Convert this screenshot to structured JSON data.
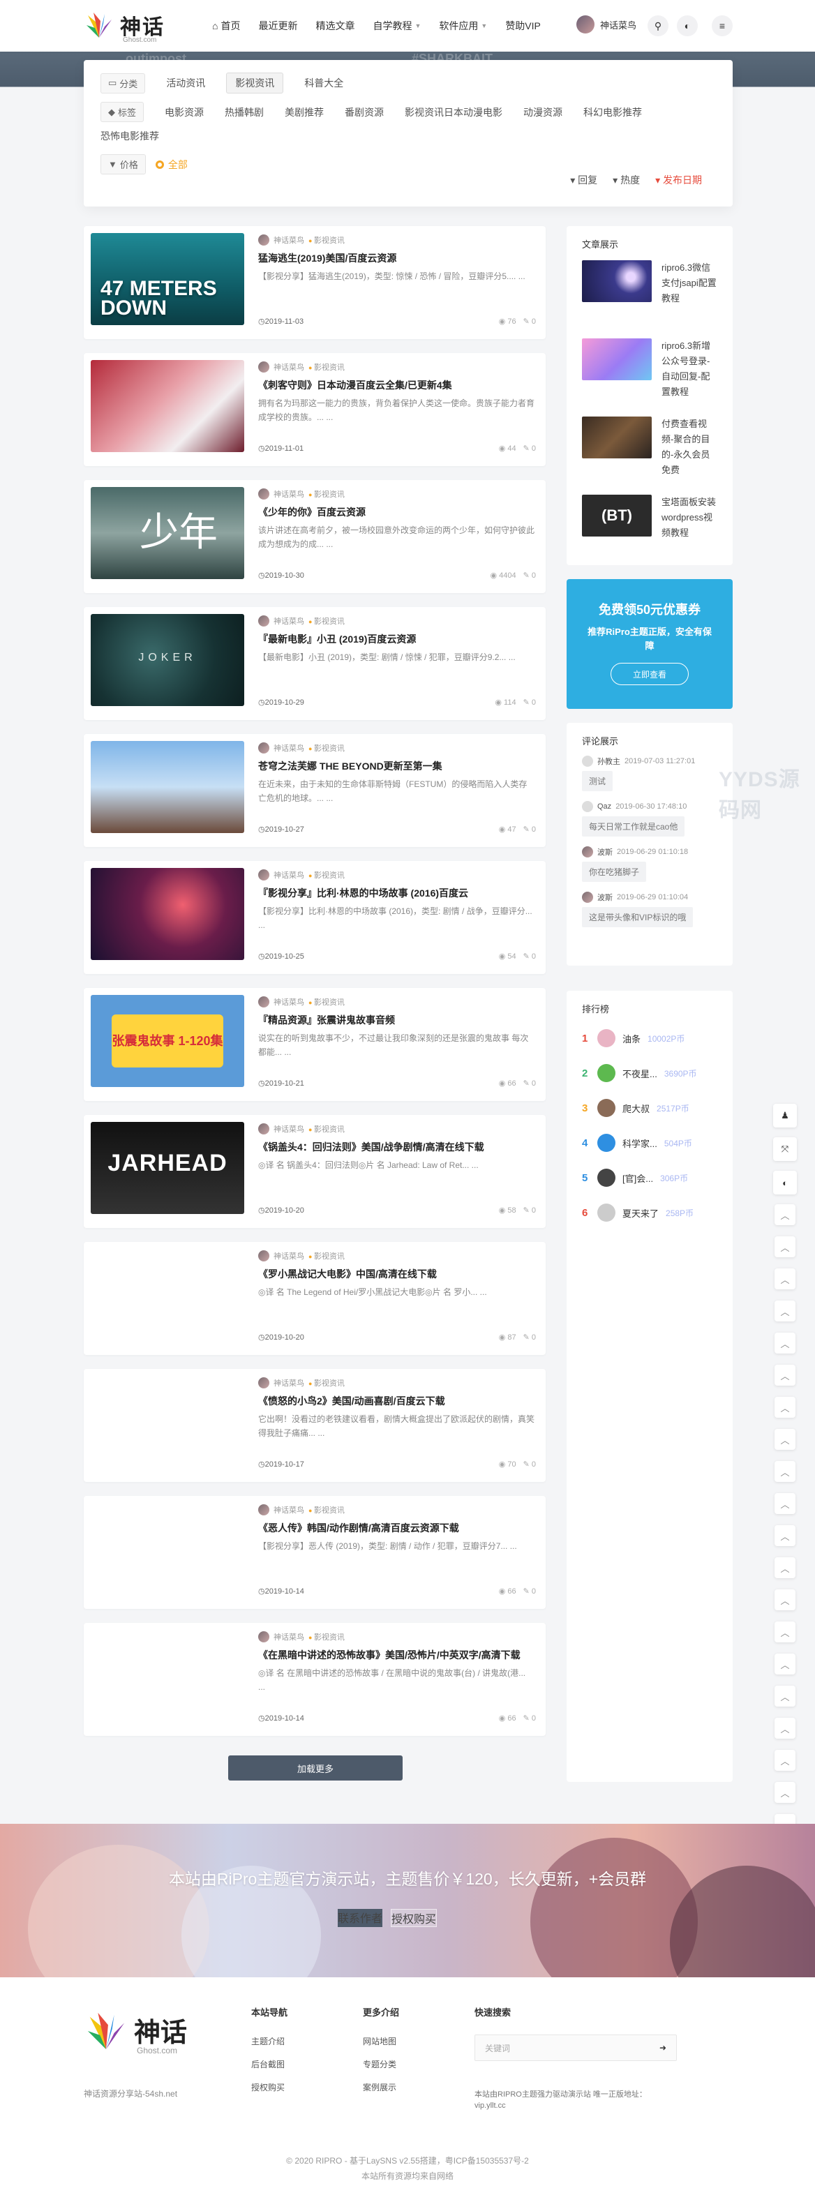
{
  "header": {
    "brand": "神话",
    "brand_sub": "Ghost.com",
    "nav": [
      {
        "label": "首页",
        "icon": "home-icon",
        "caret": false
      },
      {
        "label": "最近更新",
        "caret": false
      },
      {
        "label": "精选文章",
        "caret": false
      },
      {
        "label": "自学教程",
        "caret": true
      },
      {
        "label": "软件应用",
        "caret": true
      },
      {
        "label": "赞助VIP",
        "caret": false
      }
    ],
    "user_name": "神话菜鸟"
  },
  "hero_ghost": [
    "outimpost",
    "#SHARKBAIT"
  ],
  "filters": {
    "category_label": "分类",
    "categories": [
      "活动资讯",
      "影视资讯",
      "科普大全"
    ],
    "active_category": "影视资讯",
    "tag_label": "标签",
    "tags": [
      "电影资源",
      "热播韩剧",
      "美剧推荐",
      "番剧资源",
      "影视资讯日本动漫电影",
      "动漫资源",
      "科幻电影推荐",
      "恐怖电影推荐"
    ],
    "price_label": "价格",
    "price_all": "全部",
    "sort": [
      "回复",
      "热度",
      "发布日期"
    ]
  },
  "posts": [
    {
      "author": "神话菜鸟",
      "cat": "影视资讯",
      "title": "猛海逃生(2019)美国/百度云资源",
      "excerpt": "【影视分享】猛海逃生(2019)，类型: 惊悚 / 恐怖 / 冒险，豆瓣评分5.... ...",
      "date": "2019-11-03",
      "views": "76",
      "comments": "0",
      "thumb_text": "47 METERS DOWN"
    },
    {
      "author": "神话菜鸟",
      "cat": "影视资讯",
      "title": "《刺客守则》日本动漫百度云全集/已更新4集",
      "excerpt": "拥有名为玛那这一能力的贵族，背负着保护人类这一使命。贵族子能力者育成学校的贵族。... ...",
      "date": "2019-11-01",
      "views": "44",
      "comments": "0",
      "thumb_text": ""
    },
    {
      "author": "神话菜鸟",
      "cat": "影视资讯",
      "title": "《少年的你》百度云资源",
      "excerpt": "该片讲述在高考前夕，被一场校园意外改变命运的两个少年，如何守护彼此成为想成为的成... ...",
      "date": "2019-10-30",
      "views": "4404",
      "comments": "0",
      "thumb_text": "少年"
    },
    {
      "author": "神话菜鸟",
      "cat": "影视资讯",
      "title": "『最新电影』小丑 (2019)百度云资源",
      "excerpt": "【最新电影】小丑 (2019)，类型: 剧情 / 惊悚 / 犯罪，豆瓣评分9.2... ...",
      "date": "2019-10-29",
      "views": "114",
      "comments": "0",
      "thumb_text": "JOKER"
    },
    {
      "author": "神话菜鸟",
      "cat": "影视资讯",
      "title": "苍穹之法芙娜 THE BEYOND更新至第一集",
      "excerpt": "在近未来，由于未知的生命体菲斯特姆（FESTUM）的侵略而陷入人类存亡危机的地球。... ...",
      "date": "2019-10-27",
      "views": "47",
      "comments": "0",
      "thumb_text": ""
    },
    {
      "author": "神话菜鸟",
      "cat": "影视资讯",
      "title": "『影视分享』比利·林恩的中场故事 (2016)百度云",
      "excerpt": "【影视分享】比利·林恩的中场故事 (2016)，类型: 剧情 / 战争，豆瓣评分... ...",
      "date": "2019-10-25",
      "views": "54",
      "comments": "0",
      "thumb_text": ""
    },
    {
      "author": "神话菜鸟",
      "cat": "影视资讯",
      "title": "『精品资源』张震讲鬼故事音频",
      "excerpt": "说实在的听到鬼故事不少，不过最让我印象深刻的还是张震的鬼故事 每次都能... ...",
      "date": "2019-10-21",
      "views": "66",
      "comments": "0",
      "thumb_text": "张震鬼故事 1-120集"
    },
    {
      "author": "神话菜鸟",
      "cat": "影视资讯",
      "title": "《锅盖头4：回归法则》美国/战争剧情/高清在线下载",
      "excerpt": "◎译 名 锅盖头4：回归法则◎片 名 Jarhead: Law of Ret... ...",
      "date": "2019-10-20",
      "views": "58",
      "comments": "0",
      "thumb_text": "JARHEAD"
    },
    {
      "author": "神话菜鸟",
      "cat": "影视资讯",
      "title": "《罗小黑战记大电影》中国/高清在线下载",
      "excerpt": "◎译 名 The Legend of Hei/罗小黑战记大电影◎片 名 罗小... ...",
      "date": "2019-10-20",
      "views": "87",
      "comments": "0",
      "thumb_text": ""
    },
    {
      "author": "神话菜鸟",
      "cat": "影视资讯",
      "title": "《愤怒的小鸟2》美国/动画喜剧/百度云下载",
      "excerpt": "它出啊！没看过的老铁建议看看，剧情大概盒提出了欧派起伏的剧情，真笑得我肚子痛痛... ...",
      "date": "2019-10-17",
      "views": "70",
      "comments": "0",
      "thumb_text": ""
    },
    {
      "author": "神话菜鸟",
      "cat": "影视资讯",
      "title": "《恶人传》韩国/动作剧情/高清百度云资源下载",
      "excerpt": "【影视分享】恶人传 (2019)，类型: 剧情 / 动作 / 犯罪，豆瓣评分7... ...",
      "date": "2019-10-14",
      "views": "66",
      "comments": "0",
      "thumb_text": ""
    },
    {
      "author": "神话菜鸟",
      "cat": "影视资讯",
      "title": "《在黑暗中讲述的恐怖故事》美国/恐怖片/中英双字/高清下载",
      "excerpt": "◎译 名 在黑暗中讲述的恐怖故事 / 在黑暗中说的鬼故事(台) / 讲鬼故(港... ...",
      "date": "2019-10-14",
      "views": "66",
      "comments": "0",
      "thumb_text": ""
    }
  ],
  "load_more": "加载更多",
  "sidebar": {
    "articles_title": "文章展示",
    "articles": [
      {
        "title": "ripro6.3微信支付jsapi配置教程"
      },
      {
        "title": "ripro6.3新增公众号登录-自动回复-配置教程"
      },
      {
        "title": "付费查看视频-聚合的目的-永久会员免费"
      },
      {
        "title": "宝塔面板安装wordpress视频教程"
      }
    ],
    "promo": {
      "title": "免费领50元优惠券",
      "text": "推荐RiPro主题正版，安全有保障",
      "button": "立即查看"
    },
    "comments_title": "评论展示",
    "comments": [
      {
        "user": "孙教主",
        "time": "2019-07-03 11:27:01",
        "text": "测试"
      },
      {
        "user": "Qaz",
        "time": "2019-06-30 17:48:10",
        "text": "每天日常工作就是cao他"
      },
      {
        "user": "波斯",
        "time": "2019-06-29 01:10:18",
        "text": "你在吃猪脚子"
      },
      {
        "user": "波斯",
        "time": "2019-06-29 01:10:04",
        "text": "这是带头像和VIP标识的哦"
      }
    ],
    "rank_title": "排行榜",
    "ranks": [
      {
        "n": "1",
        "name": "油条",
        "pts": "10002P币",
        "color": "#e64b3c"
      },
      {
        "n": "2",
        "name": "不夜星...",
        "pts": "3690P币",
        "color": "#3cb371"
      },
      {
        "n": "3",
        "name": "爬大叔",
        "pts": "2517P币",
        "color": "#f5a623"
      },
      {
        "n": "4",
        "name": "科学家...",
        "pts": "504P币",
        "color": "#2e8fe1"
      },
      {
        "n": "5",
        "name": "[官]会...",
        "pts": "306P币",
        "color": "#2e8fe1"
      },
      {
        "n": "6",
        "name": "夏天来了",
        "pts": "258P币",
        "color": "#e64b3c"
      }
    ]
  },
  "watermark": "YYDS源码网",
  "banner": {
    "text": "本站由RiPro主题官方演示站，主题售价￥120，长久更新，+会员群",
    "btn1": "联系作者",
    "btn2": "授权购买"
  },
  "footer": {
    "desc": "神话资源分享站-54sh.net",
    "cols": [
      {
        "title": "本站导航",
        "items": [
          "主题介绍",
          "后台截图",
          "授权购买"
        ]
      },
      {
        "title": "更多介绍",
        "items": [
          "网站地图",
          "专题分类",
          "案例展示"
        ]
      }
    ],
    "search_title": "快速搜索",
    "search_placeholder": "关键词",
    "note": "本站由RIPRO主题强力驱动演示站 唯一正版地址：vip.yllt.cc",
    "copyright": "© 2020 RIPRO - 基于LaySNS v2.55搭建，粤ICP备15035537号-2",
    "copyright2": "本站所有资源均来自网络"
  }
}
